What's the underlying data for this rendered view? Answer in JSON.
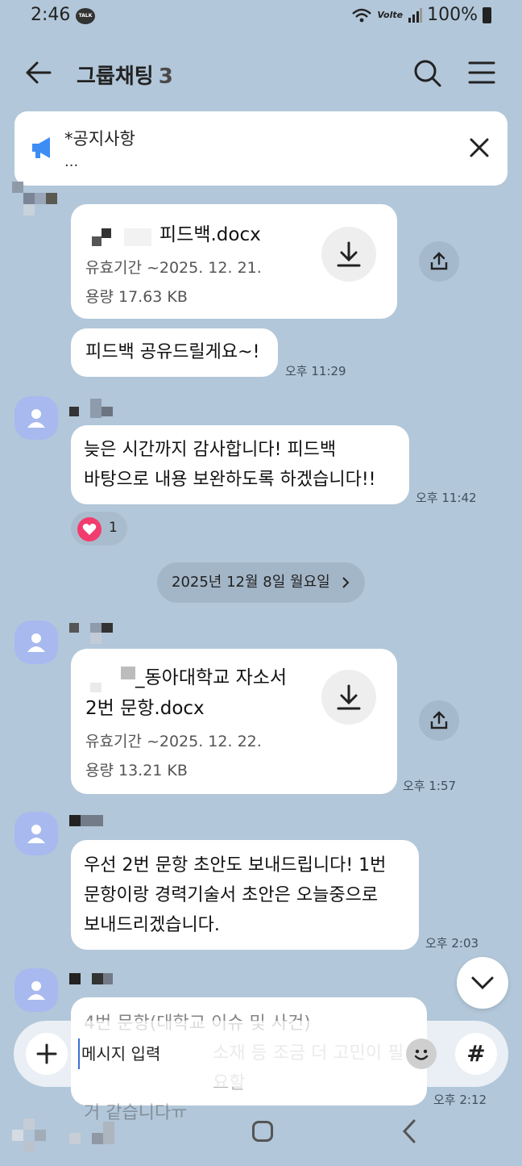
{
  "status_bar": {
    "time": "2:46",
    "talk_badge": "TALK",
    "volte": "Volte",
    "battery": "100%"
  },
  "header": {
    "title": "그룹채팅",
    "member_count": "3"
  },
  "notice": {
    "title": "*공지사항",
    "preview": "..."
  },
  "messages": [
    {
      "type": "file",
      "file_name": "피드백.docx",
      "expiry": "유효기간 ~2025. 12. 21.",
      "size": "용량  17.63 KB"
    },
    {
      "type": "text",
      "text": "피드백 공유드릴게요~!",
      "time": "오후 11:29"
    },
    {
      "type": "text",
      "lines": [
        "늦은 시간까지 감사합니다! 피드백",
        "바탕으로 내용 보완하도록 하겠습니다!!"
      ],
      "time": "오후 11:42",
      "reaction": {
        "icon": "heart-icon",
        "count": "1"
      }
    },
    {
      "type": "date",
      "text": "2025년 12월 8일 월요일"
    },
    {
      "type": "file",
      "file_name_lines": [
        "_동아대학교 자소서",
        "2번 문항.docx"
      ],
      "expiry": "유효기간 ~2025. 12. 22.",
      "size": "용량  13.21 KB",
      "time": "오후 1:57"
    },
    {
      "type": "text",
      "lines": [
        "우선 2번 문항 초안도 보내드립니다! 1번",
        "문항이랑 경력기술서 초안은 오늘중으로",
        "보내드리겠습니다."
      ],
      "time": "오후 2:03"
    },
    {
      "type": "text",
      "lines": [
        "4번 문항(대학교 이슈 및 사건)",
        "소재 등 조금 더 고민이 필요할",
        "거 같습니다ㅠ"
      ],
      "time": "오후 2:12"
    }
  ],
  "input": {
    "placeholder": "메시지 입력",
    "hash_label": "#"
  },
  "colors": {
    "background": "#b2c7d9",
    "bubble": "#ffffff",
    "avatar": "#a8b9ef",
    "heart": "#f23c6d",
    "notice_icon": "#3d8df5"
  }
}
